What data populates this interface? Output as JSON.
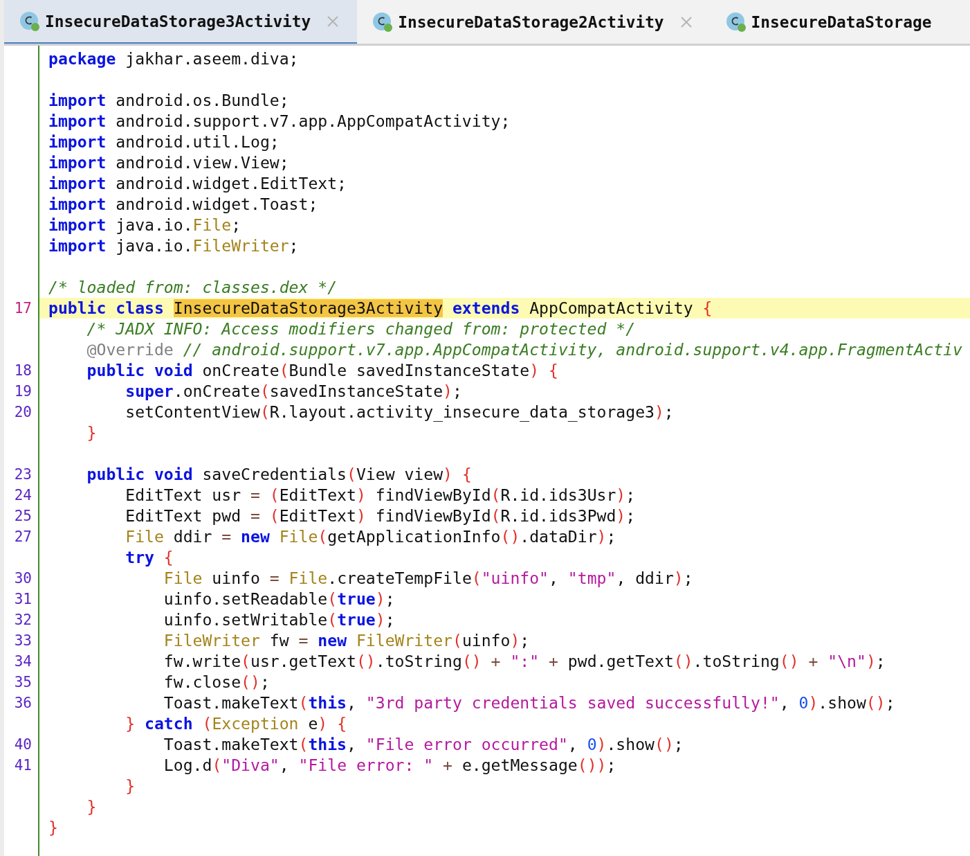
{
  "tabs": [
    {
      "label": "InsecureDataStorage3Activity",
      "selected": true,
      "closable": true
    },
    {
      "label": "InsecureDataStorage2Activity",
      "selected": false,
      "closable": true
    },
    {
      "label": "InsecureDataStorage",
      "selected": false,
      "closable": false
    }
  ],
  "lines": [
    {
      "current": false,
      "tokens": [
        {
          "kind": "keyword",
          "text": "package"
        },
        {
          "kind": "plain",
          "text": " jakhar.aseem.diva;"
        }
      ]
    },
    {
      "current": false
    },
    {
      "current": false,
      "tokens": [
        {
          "kind": "keyword",
          "text": "import"
        },
        {
          "kind": "plain",
          "text": " android.os.Bundle;"
        }
      ]
    },
    {
      "current": false,
      "tokens": [
        {
          "kind": "keyword",
          "text": "import"
        },
        {
          "kind": "plain",
          "text": " android.support.v7.app.AppCompatActivity;"
        }
      ]
    },
    {
      "current": false,
      "tokens": [
        {
          "kind": "keyword",
          "text": "import"
        },
        {
          "kind": "plain",
          "text": " android.util.Log;"
        }
      ]
    },
    {
      "current": false,
      "tokens": [
        {
          "kind": "keyword",
          "text": "import"
        },
        {
          "kind": "plain",
          "text": " android.view.View;"
        }
      ]
    },
    {
      "current": false,
      "tokens": [
        {
          "kind": "keyword",
          "text": "import"
        },
        {
          "kind": "plain",
          "text": " android.widget.EditText;"
        }
      ]
    },
    {
      "current": false,
      "tokens": [
        {
          "kind": "keyword",
          "text": "import"
        },
        {
          "kind": "plain",
          "text": " android.widget.Toast;"
        }
      ]
    },
    {
      "current": false,
      "tokens": [
        {
          "kind": "keyword",
          "text": "import"
        },
        {
          "kind": "plain",
          "text": " java.io."
        },
        {
          "kind": "type",
          "text": "File"
        },
        {
          "kind": "plain",
          "text": ";"
        }
      ]
    },
    {
      "current": false,
      "tokens": [
        {
          "kind": "keyword",
          "text": "import"
        },
        {
          "kind": "plain",
          "text": " java.io."
        },
        {
          "kind": "type",
          "text": "FileWriter"
        },
        {
          "kind": "plain",
          "text": ";"
        }
      ]
    },
    {
      "current": false
    },
    {
      "current": false,
      "tokens": [
        {
          "kind": "comment",
          "text": "/* loaded from: classes.dex */"
        }
      ]
    },
    {
      "number": "17",
      "current": true,
      "tokens": [
        {
          "kind": "keyword",
          "text": "public class "
        },
        {
          "kind": "match",
          "text": "InsecureDataStorage3Activity"
        },
        {
          "kind": "keyword",
          "text": " extends"
        },
        {
          "kind": "plain",
          "text": " AppCompatActivity "
        },
        {
          "kind": "bracket",
          "text": "{"
        }
      ]
    },
    {
      "current": false,
      "tokens": [
        {
          "kind": "comment",
          "text": "    /* JADX INFO: Access modifiers changed from: protected */"
        }
      ]
    },
    {
      "current": false,
      "tokens": [
        {
          "kind": "annotation",
          "text": "    @Override "
        },
        {
          "kind": "comment",
          "text": "// android.support.v7.app.AppCompatActivity, android.support.v4.app.FragmentActiv"
        }
      ]
    },
    {
      "number": "18",
      "current": false,
      "tokens": [
        {
          "kind": "keyword",
          "text": "    public void"
        },
        {
          "kind": "plain",
          "text": " onCreate"
        },
        {
          "kind": "bracket",
          "text": "("
        },
        {
          "kind": "plain",
          "text": "Bundle savedInstanceState"
        },
        {
          "kind": "bracket",
          "text": ") {"
        }
      ]
    },
    {
      "number": "19",
      "current": false,
      "tokens": [
        {
          "kind": "keyword",
          "text": "        super"
        },
        {
          "kind": "plain",
          "text": ".onCreate"
        },
        {
          "kind": "bracket",
          "text": "("
        },
        {
          "kind": "plain",
          "text": "savedInstanceState"
        },
        {
          "kind": "bracket",
          "text": ")"
        },
        {
          "kind": "plain",
          "text": ";"
        }
      ]
    },
    {
      "number": "20",
      "current": false,
      "tokens": [
        {
          "kind": "plain",
          "text": "        setContentView"
        },
        {
          "kind": "bracket",
          "text": "("
        },
        {
          "kind": "plain",
          "text": "R.layout.activity_insecure_data_storage3"
        },
        {
          "kind": "bracket",
          "text": ")"
        },
        {
          "kind": "plain",
          "text": ";"
        }
      ]
    },
    {
      "current": false,
      "tokens": [
        {
          "kind": "bracket",
          "text": "    }"
        }
      ]
    },
    {
      "current": false
    },
    {
      "number": "23",
      "current": false,
      "tokens": [
        {
          "kind": "keyword",
          "text": "    public void"
        },
        {
          "kind": "plain",
          "text": " saveCredentials"
        },
        {
          "kind": "bracket",
          "text": "("
        },
        {
          "kind": "plain",
          "text": "View view"
        },
        {
          "kind": "bracket",
          "text": ") {"
        }
      ]
    },
    {
      "number": "24",
      "current": false,
      "tokens": [
        {
          "kind": "plain",
          "text": "        EditText usr "
        },
        {
          "kind": "operator",
          "text": "= "
        },
        {
          "kind": "bracket",
          "text": "("
        },
        {
          "kind": "plain",
          "text": "EditText"
        },
        {
          "kind": "bracket",
          "text": ")"
        },
        {
          "kind": "plain",
          "text": " findViewById"
        },
        {
          "kind": "bracket",
          "text": "("
        },
        {
          "kind": "plain",
          "text": "R.id.ids3Usr"
        },
        {
          "kind": "bracket",
          "text": ")"
        },
        {
          "kind": "plain",
          "text": ";"
        }
      ]
    },
    {
      "number": "25",
      "current": false,
      "tokens": [
        {
          "kind": "plain",
          "text": "        EditText pwd "
        },
        {
          "kind": "operator",
          "text": "= "
        },
        {
          "kind": "bracket",
          "text": "("
        },
        {
          "kind": "plain",
          "text": "EditText"
        },
        {
          "kind": "bracket",
          "text": ")"
        },
        {
          "kind": "plain",
          "text": " findViewById"
        },
        {
          "kind": "bracket",
          "text": "("
        },
        {
          "kind": "plain",
          "text": "R.id.ids3Pwd"
        },
        {
          "kind": "bracket",
          "text": ")"
        },
        {
          "kind": "plain",
          "text": ";"
        }
      ]
    },
    {
      "number": "27",
      "current": false,
      "tokens": [
        {
          "kind": "type",
          "text": "        File"
        },
        {
          "kind": "plain",
          "text": " ddir "
        },
        {
          "kind": "operator",
          "text": "= "
        },
        {
          "kind": "keyword",
          "text": "new "
        },
        {
          "kind": "type",
          "text": "File"
        },
        {
          "kind": "bracket",
          "text": "("
        },
        {
          "kind": "plain",
          "text": "getApplicationInfo"
        },
        {
          "kind": "bracket",
          "text": "()"
        },
        {
          "kind": "plain",
          "text": ".dataDir"
        },
        {
          "kind": "bracket",
          "text": ")"
        },
        {
          "kind": "plain",
          "text": ";"
        }
      ]
    },
    {
      "current": false,
      "tokens": [
        {
          "kind": "keyword",
          "text": "        try"
        },
        {
          "kind": "bracket",
          "text": " {"
        }
      ]
    },
    {
      "number": "30",
      "current": false,
      "tokens": [
        {
          "kind": "type",
          "text": "            File"
        },
        {
          "kind": "plain",
          "text": " uinfo "
        },
        {
          "kind": "operator",
          "text": "= "
        },
        {
          "kind": "type",
          "text": "File"
        },
        {
          "kind": "plain",
          "text": ".createTempFile"
        },
        {
          "kind": "bracket",
          "text": "("
        },
        {
          "kind": "string",
          "text": "\"uinfo\""
        },
        {
          "kind": "plain",
          "text": ", "
        },
        {
          "kind": "string",
          "text": "\"tmp\""
        },
        {
          "kind": "plain",
          "text": ", ddir"
        },
        {
          "kind": "bracket",
          "text": ")"
        },
        {
          "kind": "plain",
          "text": ";"
        }
      ]
    },
    {
      "number": "31",
      "current": false,
      "tokens": [
        {
          "kind": "plain",
          "text": "            uinfo.setReadable"
        },
        {
          "kind": "bracket",
          "text": "("
        },
        {
          "kind": "keyword",
          "text": "true"
        },
        {
          "kind": "bracket",
          "text": ")"
        },
        {
          "kind": "plain",
          "text": ";"
        }
      ]
    },
    {
      "number": "32",
      "current": false,
      "tokens": [
        {
          "kind": "plain",
          "text": "            uinfo.setWritable"
        },
        {
          "kind": "bracket",
          "text": "("
        },
        {
          "kind": "keyword",
          "text": "true"
        },
        {
          "kind": "bracket",
          "text": ")"
        },
        {
          "kind": "plain",
          "text": ";"
        }
      ]
    },
    {
      "number": "33",
      "current": false,
      "tokens": [
        {
          "kind": "type",
          "text": "            FileWriter"
        },
        {
          "kind": "plain",
          "text": " fw "
        },
        {
          "kind": "operator",
          "text": "= "
        },
        {
          "kind": "keyword",
          "text": "new "
        },
        {
          "kind": "type",
          "text": "FileWriter"
        },
        {
          "kind": "bracket",
          "text": "("
        },
        {
          "kind": "plain",
          "text": "uinfo"
        },
        {
          "kind": "bracket",
          "text": ")"
        },
        {
          "kind": "plain",
          "text": ";"
        }
      ]
    },
    {
      "number": "34",
      "current": false,
      "tokens": [
        {
          "kind": "plain",
          "text": "            fw.write"
        },
        {
          "kind": "bracket",
          "text": "("
        },
        {
          "kind": "plain",
          "text": "usr.getText"
        },
        {
          "kind": "bracket",
          "text": "()"
        },
        {
          "kind": "plain",
          "text": ".toString"
        },
        {
          "kind": "bracket",
          "text": "()"
        },
        {
          "kind": "operator",
          "text": " + "
        },
        {
          "kind": "string",
          "text": "\":\""
        },
        {
          "kind": "operator",
          "text": " +"
        },
        {
          "kind": "plain",
          "text": " pwd.getText"
        },
        {
          "kind": "bracket",
          "text": "()"
        },
        {
          "kind": "plain",
          "text": ".toString"
        },
        {
          "kind": "bracket",
          "text": "()"
        },
        {
          "kind": "operator",
          "text": " + "
        },
        {
          "kind": "string",
          "text": "\"\\n\""
        },
        {
          "kind": "bracket",
          "text": ")"
        },
        {
          "kind": "plain",
          "text": ";"
        }
      ]
    },
    {
      "number": "35",
      "current": false,
      "tokens": [
        {
          "kind": "plain",
          "text": "            fw.close"
        },
        {
          "kind": "bracket",
          "text": "()"
        },
        {
          "kind": "plain",
          "text": ";"
        }
      ]
    },
    {
      "number": "36",
      "current": false,
      "tokens": [
        {
          "kind": "plain",
          "text": "            Toast.makeText"
        },
        {
          "kind": "bracket",
          "text": "("
        },
        {
          "kind": "keyword",
          "text": "this"
        },
        {
          "kind": "plain",
          "text": ", "
        },
        {
          "kind": "string",
          "text": "\"3rd party credentials saved successfully!\""
        },
        {
          "kind": "plain",
          "text": ", "
        },
        {
          "kind": "number",
          "text": "0"
        },
        {
          "kind": "bracket",
          "text": ")"
        },
        {
          "kind": "plain",
          "text": ".show"
        },
        {
          "kind": "bracket",
          "text": "()"
        },
        {
          "kind": "plain",
          "text": ";"
        }
      ]
    },
    {
      "current": false,
      "tokens": [
        {
          "kind": "bracket",
          "text": "        } "
        },
        {
          "kind": "keyword",
          "text": "catch "
        },
        {
          "kind": "bracket",
          "text": "("
        },
        {
          "kind": "type",
          "text": "Exception"
        },
        {
          "kind": "plain",
          "text": " e"
        },
        {
          "kind": "bracket",
          "text": ") {"
        }
      ]
    },
    {
      "number": "40",
      "current": false,
      "tokens": [
        {
          "kind": "plain",
          "text": "            Toast.makeText"
        },
        {
          "kind": "bracket",
          "text": "("
        },
        {
          "kind": "keyword",
          "text": "this"
        },
        {
          "kind": "plain",
          "text": ", "
        },
        {
          "kind": "string",
          "text": "\"File error occurred\""
        },
        {
          "kind": "plain",
          "text": ", "
        },
        {
          "kind": "number",
          "text": "0"
        },
        {
          "kind": "bracket",
          "text": ")"
        },
        {
          "kind": "plain",
          "text": ".show"
        },
        {
          "kind": "bracket",
          "text": "()"
        },
        {
          "kind": "plain",
          "text": ";"
        }
      ]
    },
    {
      "number": "41",
      "current": false,
      "tokens": [
        {
          "kind": "plain",
          "text": "            Log.d"
        },
        {
          "kind": "bracket",
          "text": "("
        },
        {
          "kind": "string",
          "text": "\"Diva\""
        },
        {
          "kind": "plain",
          "text": ", "
        },
        {
          "kind": "string",
          "text": "\"File error: \""
        },
        {
          "kind": "operator",
          "text": " +"
        },
        {
          "kind": "plain",
          "text": " e.getMessage"
        },
        {
          "kind": "bracket",
          "text": "())"
        },
        {
          "kind": "plain",
          "text": ";"
        }
      ]
    },
    {
      "current": false,
      "tokens": [
        {
          "kind": "bracket",
          "text": "        }"
        }
      ]
    },
    {
      "current": false,
      "tokens": [
        {
          "kind": "bracket",
          "text": "    }"
        }
      ]
    },
    {
      "current": false,
      "tokens": [
        {
          "kind": "bracket",
          "text": "}"
        }
      ]
    }
  ]
}
